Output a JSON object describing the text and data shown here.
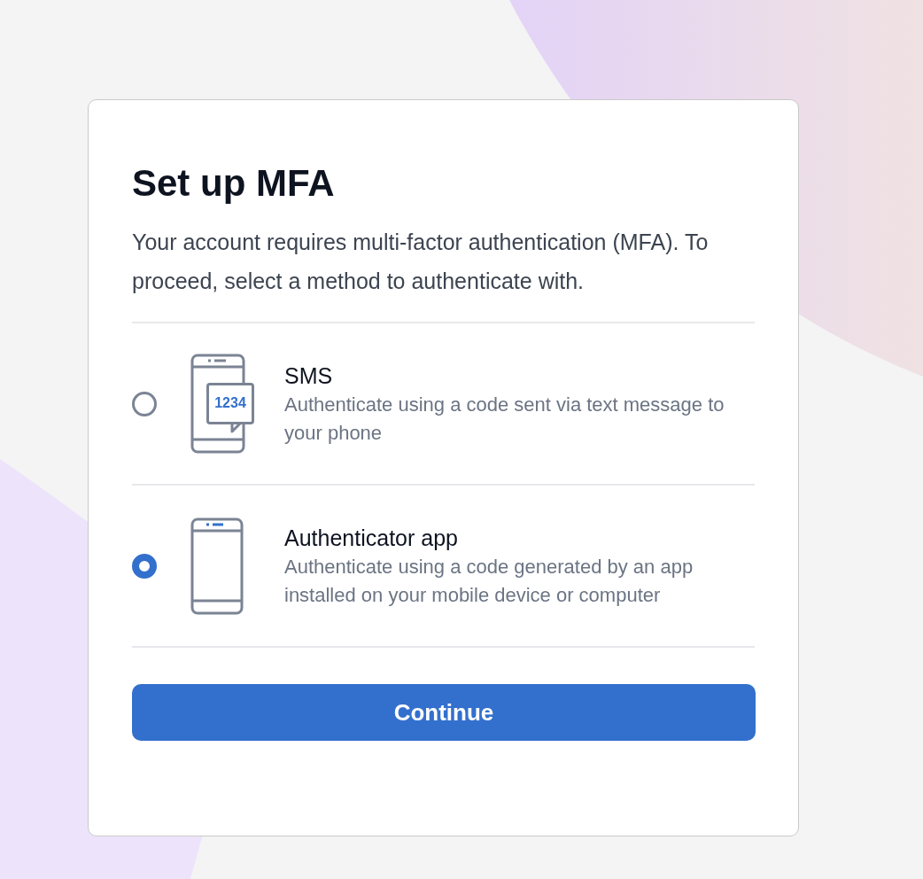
{
  "title": "Set up MFA",
  "description": "Your account requires multi-factor authentication (MFA). To proceed, select a method to authenticate with.",
  "options": [
    {
      "kind": "sms",
      "name": "SMS",
      "detail": "Authenticate using a code sent via text message to your phone",
      "code": "1234",
      "selected": false
    },
    {
      "kind": "app",
      "name": "Authenticator app",
      "detail": "Authenticate using a code generated by an app installed on your mobile device or computer",
      "selected": true
    }
  ],
  "button": "Continue"
}
